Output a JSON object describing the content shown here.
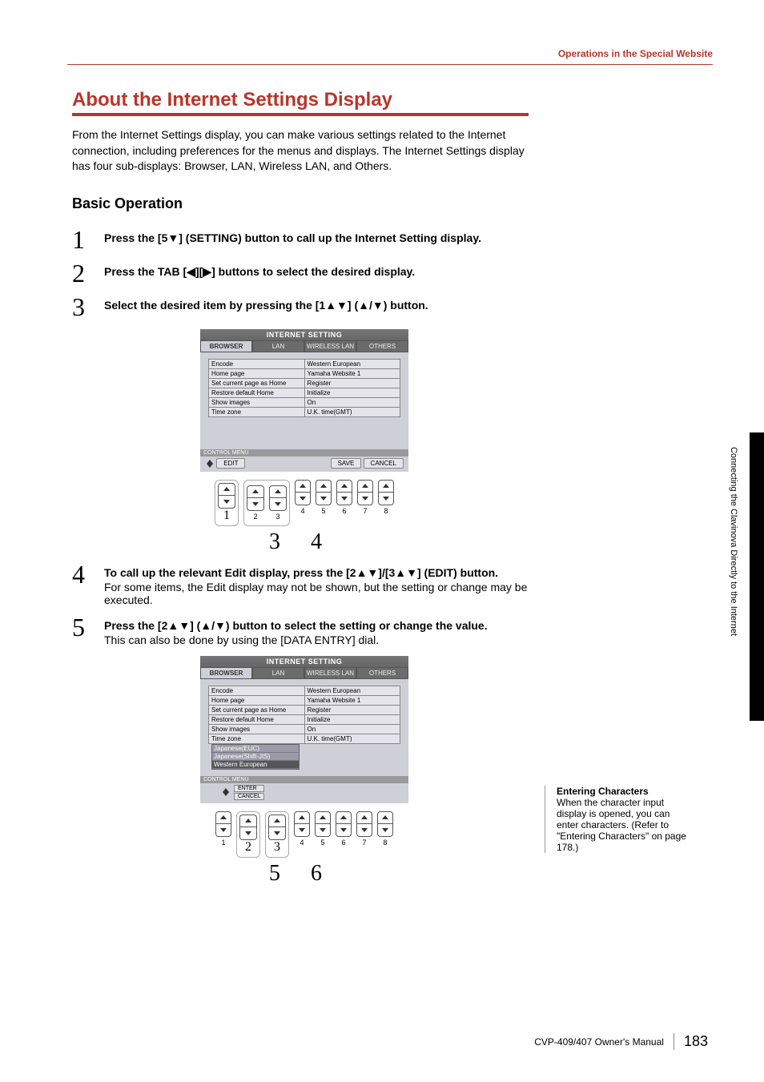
{
  "header": {
    "section_title": "Operations in the Special Website"
  },
  "h1": "About the Internet Settings Display",
  "intro": "From the Internet Settings display, you can make various settings related to the Internet connection, including preferences for the menus and displays. The Internet Settings display has four sub-displays: Browser, LAN, Wireless LAN, and Others.",
  "h2": "Basic Operation",
  "steps": {
    "1": {
      "num": "1",
      "text": "Press the [5▼] (SETTING) button to call up the Internet Setting display."
    },
    "2": {
      "num": "2",
      "text": "Press the TAB [◀][▶] buttons to select the desired display."
    },
    "3": {
      "num": "3",
      "text": "Select the desired item by pressing the [1▲▼] (▲/▼) button."
    },
    "4": {
      "num": "4",
      "text": "To call up the relevant Edit display, press the [2▲▼]/[3▲▼] (EDIT) button.",
      "desc": "For some items, the Edit display may not be shown, but the setting or change may be executed."
    },
    "5": {
      "num": "5",
      "text": "Press the [2▲▼] (▲/▼) button to select the setting or change the value.",
      "desc": "This can also be done by using the [DATA ENTRY] dial."
    }
  },
  "figure": {
    "title": "INTERNET SETTING",
    "tabs": [
      "BROWSER",
      "LAN",
      "WIRELESS LAN",
      "OTHERS"
    ],
    "rows": [
      [
        "Encode",
        "Western European"
      ],
      [
        "Home page",
        "Yamaha Website 1"
      ],
      [
        "Set current page as Home",
        "Register"
      ],
      [
        "Restore default Home",
        "Initialize"
      ],
      [
        "Show images",
        "On"
      ],
      [
        "Time zone",
        "U.K. time(GMT)"
      ]
    ],
    "control_menu": "CONTROL MENU",
    "edit": "EDIT",
    "save": "SAVE",
    "cancel": "CANCEL",
    "popup": [
      "Japanese(EUC)",
      "Japanese(Shift-JIS)",
      "Western European"
    ],
    "enter": "ENTER",
    "cancel2": "CANCEL",
    "button_numbers": [
      "1",
      "2",
      "3",
      "4",
      "5",
      "6",
      "7",
      "8"
    ]
  },
  "callouts": {
    "fig1_a": "3",
    "fig1_b": "4",
    "fig2_a": "5",
    "fig2_b": "6"
  },
  "sidebar": {
    "title": "Entering Characters",
    "text": "When the character input display is opened, you can enter characters. (Refer to \"Entering Characters\" on page 178.)"
  },
  "vertical": "Connecting the Clavinova Directly to the Internet",
  "footer": {
    "manual": "CVP-409/407 Owner's Manual",
    "page": "183"
  }
}
